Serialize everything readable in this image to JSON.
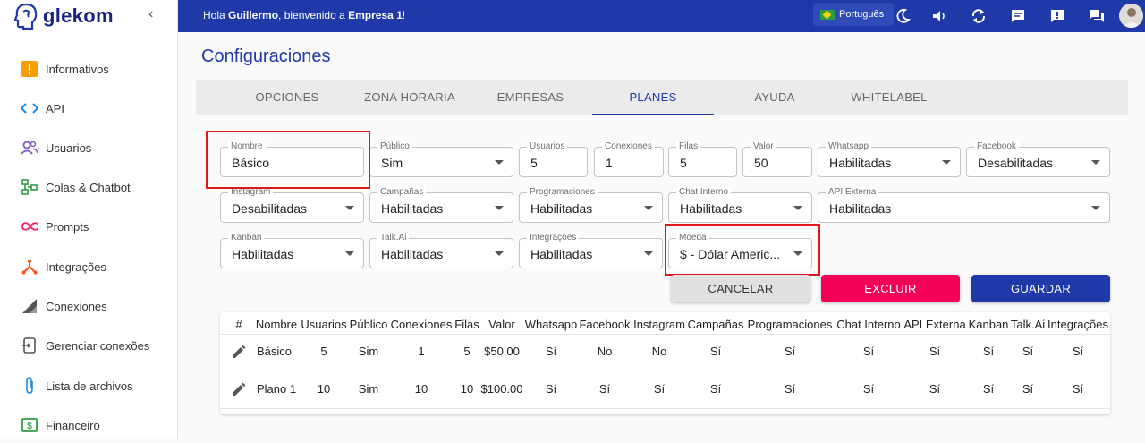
{
  "sidebar": {
    "brand": "glekom",
    "items": [
      {
        "label": "Informativos",
        "icon": "alert-square-icon"
      },
      {
        "label": "API",
        "icon": "code-icon"
      },
      {
        "label": "Usuarios",
        "icon": "people-icon"
      },
      {
        "label": "Colas & Chatbot",
        "icon": "flow-icon"
      },
      {
        "label": "Prompts",
        "icon": "infinity-icon"
      },
      {
        "label": "Integrações",
        "icon": "integration-icon"
      },
      {
        "label": "Conexiones",
        "icon": "signal-icon"
      },
      {
        "label": "Gerenciar conexões",
        "icon": "connection-manage-icon"
      },
      {
        "label": "Lista de archivos",
        "icon": "paperclip-icon"
      },
      {
        "label": "Financeiro",
        "icon": "dollar-icon"
      }
    ]
  },
  "topbar": {
    "greet_prefix": "Hola ",
    "user": "Guillermo",
    "greet_mid": ", bienvenido a ",
    "company": "Empresa 1",
    "greet_suffix": "!",
    "language": "Português"
  },
  "page": {
    "title": "Configuraciones"
  },
  "tabs": [
    "OPCIONES",
    "ZONA HORARIA",
    "EMPRESAS",
    "PLANES",
    "AYUDA",
    "WHITELABEL"
  ],
  "active_tab": "PLANES",
  "form": {
    "nombre": {
      "label": "Nombre",
      "value": "Básico"
    },
    "publico": {
      "label": "Público",
      "value": "Sim"
    },
    "usuarios": {
      "label": "Usuarios",
      "value": "5"
    },
    "conexiones": {
      "label": "Conexiones",
      "value": "1"
    },
    "filas": {
      "label": "Filas",
      "value": "5"
    },
    "valor": {
      "label": "Valor",
      "value": "50"
    },
    "whatsapp": {
      "label": "Whatsapp",
      "value": "Habilitadas"
    },
    "facebook": {
      "label": "Facebook",
      "value": "Desabilitadas"
    },
    "instagram": {
      "label": "Instagram",
      "value": "Desabilitadas"
    },
    "campanas": {
      "label": "Campañas",
      "value": "Habilitadas"
    },
    "programaciones": {
      "label": "Programaciones",
      "value": "Habilitadas"
    },
    "chat_interno": {
      "label": "Chat Interno",
      "value": "Habilitadas"
    },
    "api_externa": {
      "label": "API Externa",
      "value": "Habilitadas"
    },
    "kanban": {
      "label": "Kanban",
      "value": "Habilitadas"
    },
    "talk_ai": {
      "label": "Talk.Ai",
      "value": "Habilitadas"
    },
    "integracoes": {
      "label": "Integrações",
      "value": "Habilitadas"
    },
    "moeda": {
      "label": "Moeda",
      "value": "$ - Dólar Americ..."
    }
  },
  "buttons": {
    "cancel": "CANCELAR",
    "delete": "EXCLUIR",
    "save": "GUARDAR"
  },
  "table": {
    "headers": [
      "#",
      "Nombre",
      "Usuarios",
      "Público",
      "Conexiones",
      "Filas",
      "Valor",
      "Whatsapp",
      "Facebook",
      "Instagram",
      "Campañas",
      "Programaciones",
      "Chat Interno",
      "API Externa",
      "Kanban",
      "Talk.Ai",
      "Integrações"
    ],
    "rows": [
      [
        "Básico",
        "5",
        "Sim",
        "1",
        "5",
        "$50.00",
        "Sí",
        "No",
        "No",
        "Sí",
        "Sí",
        "Sí",
        "Sí",
        "Sí",
        "Sí",
        "Sí"
      ],
      [
        "Plano 1",
        "10",
        "Sim",
        "10",
        "10",
        "$100.00",
        "Sí",
        "Sí",
        "Sí",
        "Sí",
        "Sí",
        "Sí",
        "Sí",
        "Sí",
        "Sí",
        "Sí"
      ]
    ]
  },
  "colors": {
    "primary": "#1f3aa8",
    "danger": "#f50057",
    "highlight": "#e0181c"
  }
}
